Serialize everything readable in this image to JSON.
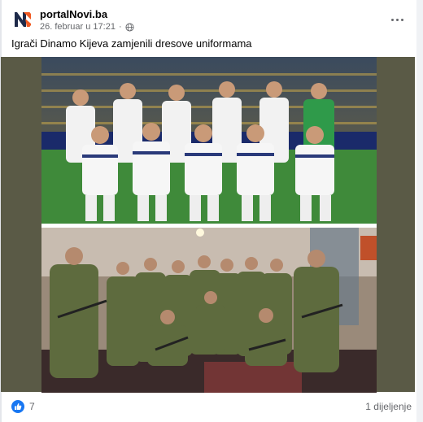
{
  "post": {
    "page_name": "portalNovi.ba",
    "date": "26. februar u 17:21",
    "separator": "·",
    "text": "Igrači Dinamo Kijeva zamjenili dresove uniformama"
  },
  "media": {
    "top_photo": "team-photo-in-kits",
    "bottom_photo": "team-photo-in-military-uniforms"
  },
  "engagement": {
    "reaction_count": "7",
    "shares": "1 dijeljenje"
  },
  "colors": {
    "accent": "#1877f2",
    "logo_orange": "#f15a22",
    "logo_dark": "#1e2a4a",
    "media_background": "#5a5a46"
  },
  "icons": [
    "globe-icon",
    "more-options-icon",
    "like-icon",
    "portal-logo"
  ]
}
